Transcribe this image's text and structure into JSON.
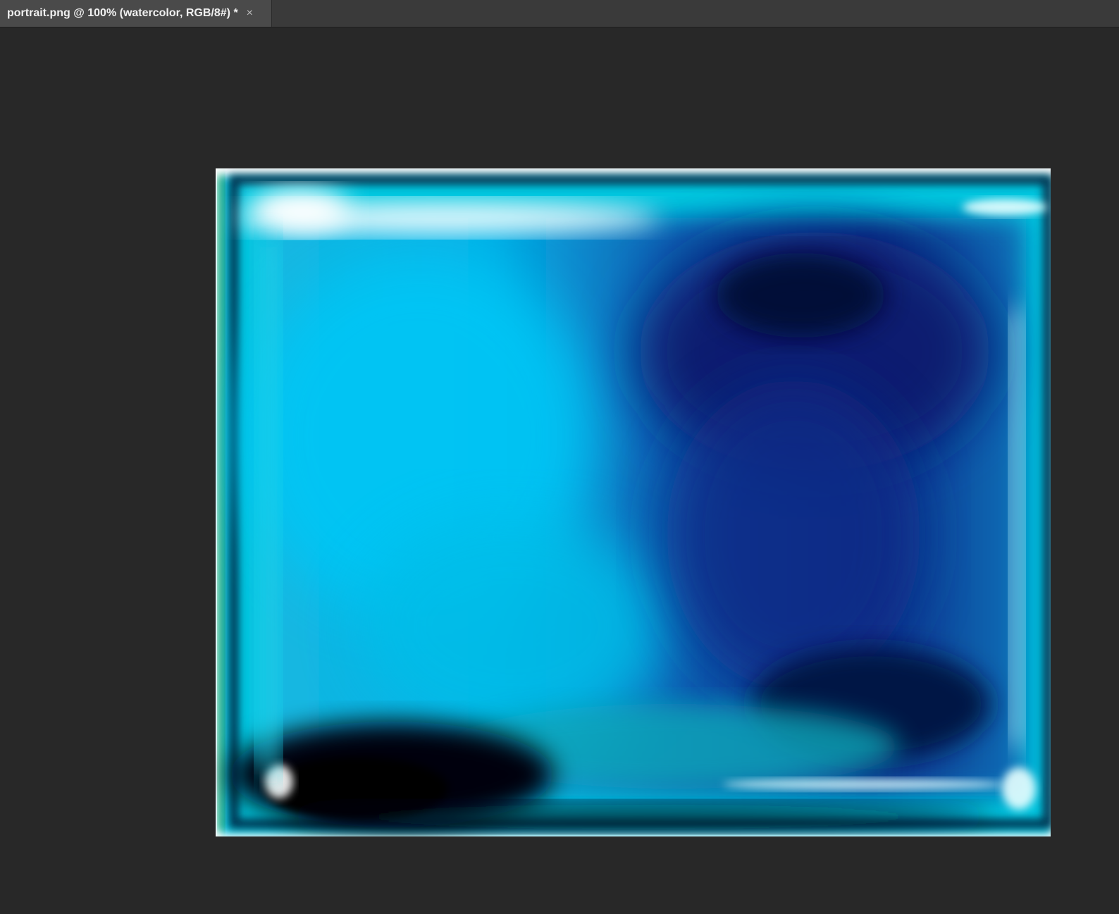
{
  "tab": {
    "title": "portrait.png @ 100% (watercolor, RGB/8#) *",
    "close_glyph": "×",
    "close_icon": "close-icon"
  },
  "canvas": {
    "background_color": "#282828",
    "image": {
      "description_icon": "watercolor-artwork",
      "colors": [
        "#00d8f0",
        "#0a2a80",
        "#000814",
        "#ffffff",
        "#00a060"
      ]
    }
  }
}
